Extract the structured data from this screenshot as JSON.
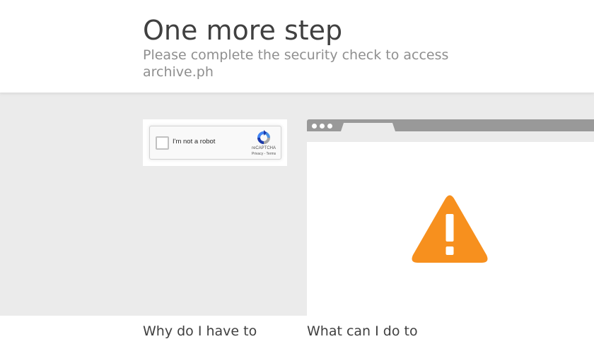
{
  "header": {
    "title": "One more step",
    "subtitle": "Please complete the security check to access archive.ph"
  },
  "captcha": {
    "label": "I'm not a robot",
    "brand": "reCAPTCHA",
    "links": "Privacy - Terms",
    "checked": false
  },
  "illustration": {
    "icon": "warning-icon",
    "accent_color": "#f7901e"
  },
  "footer": {
    "left_heading": "Why do I have to",
    "right_heading": "What can I do to"
  }
}
